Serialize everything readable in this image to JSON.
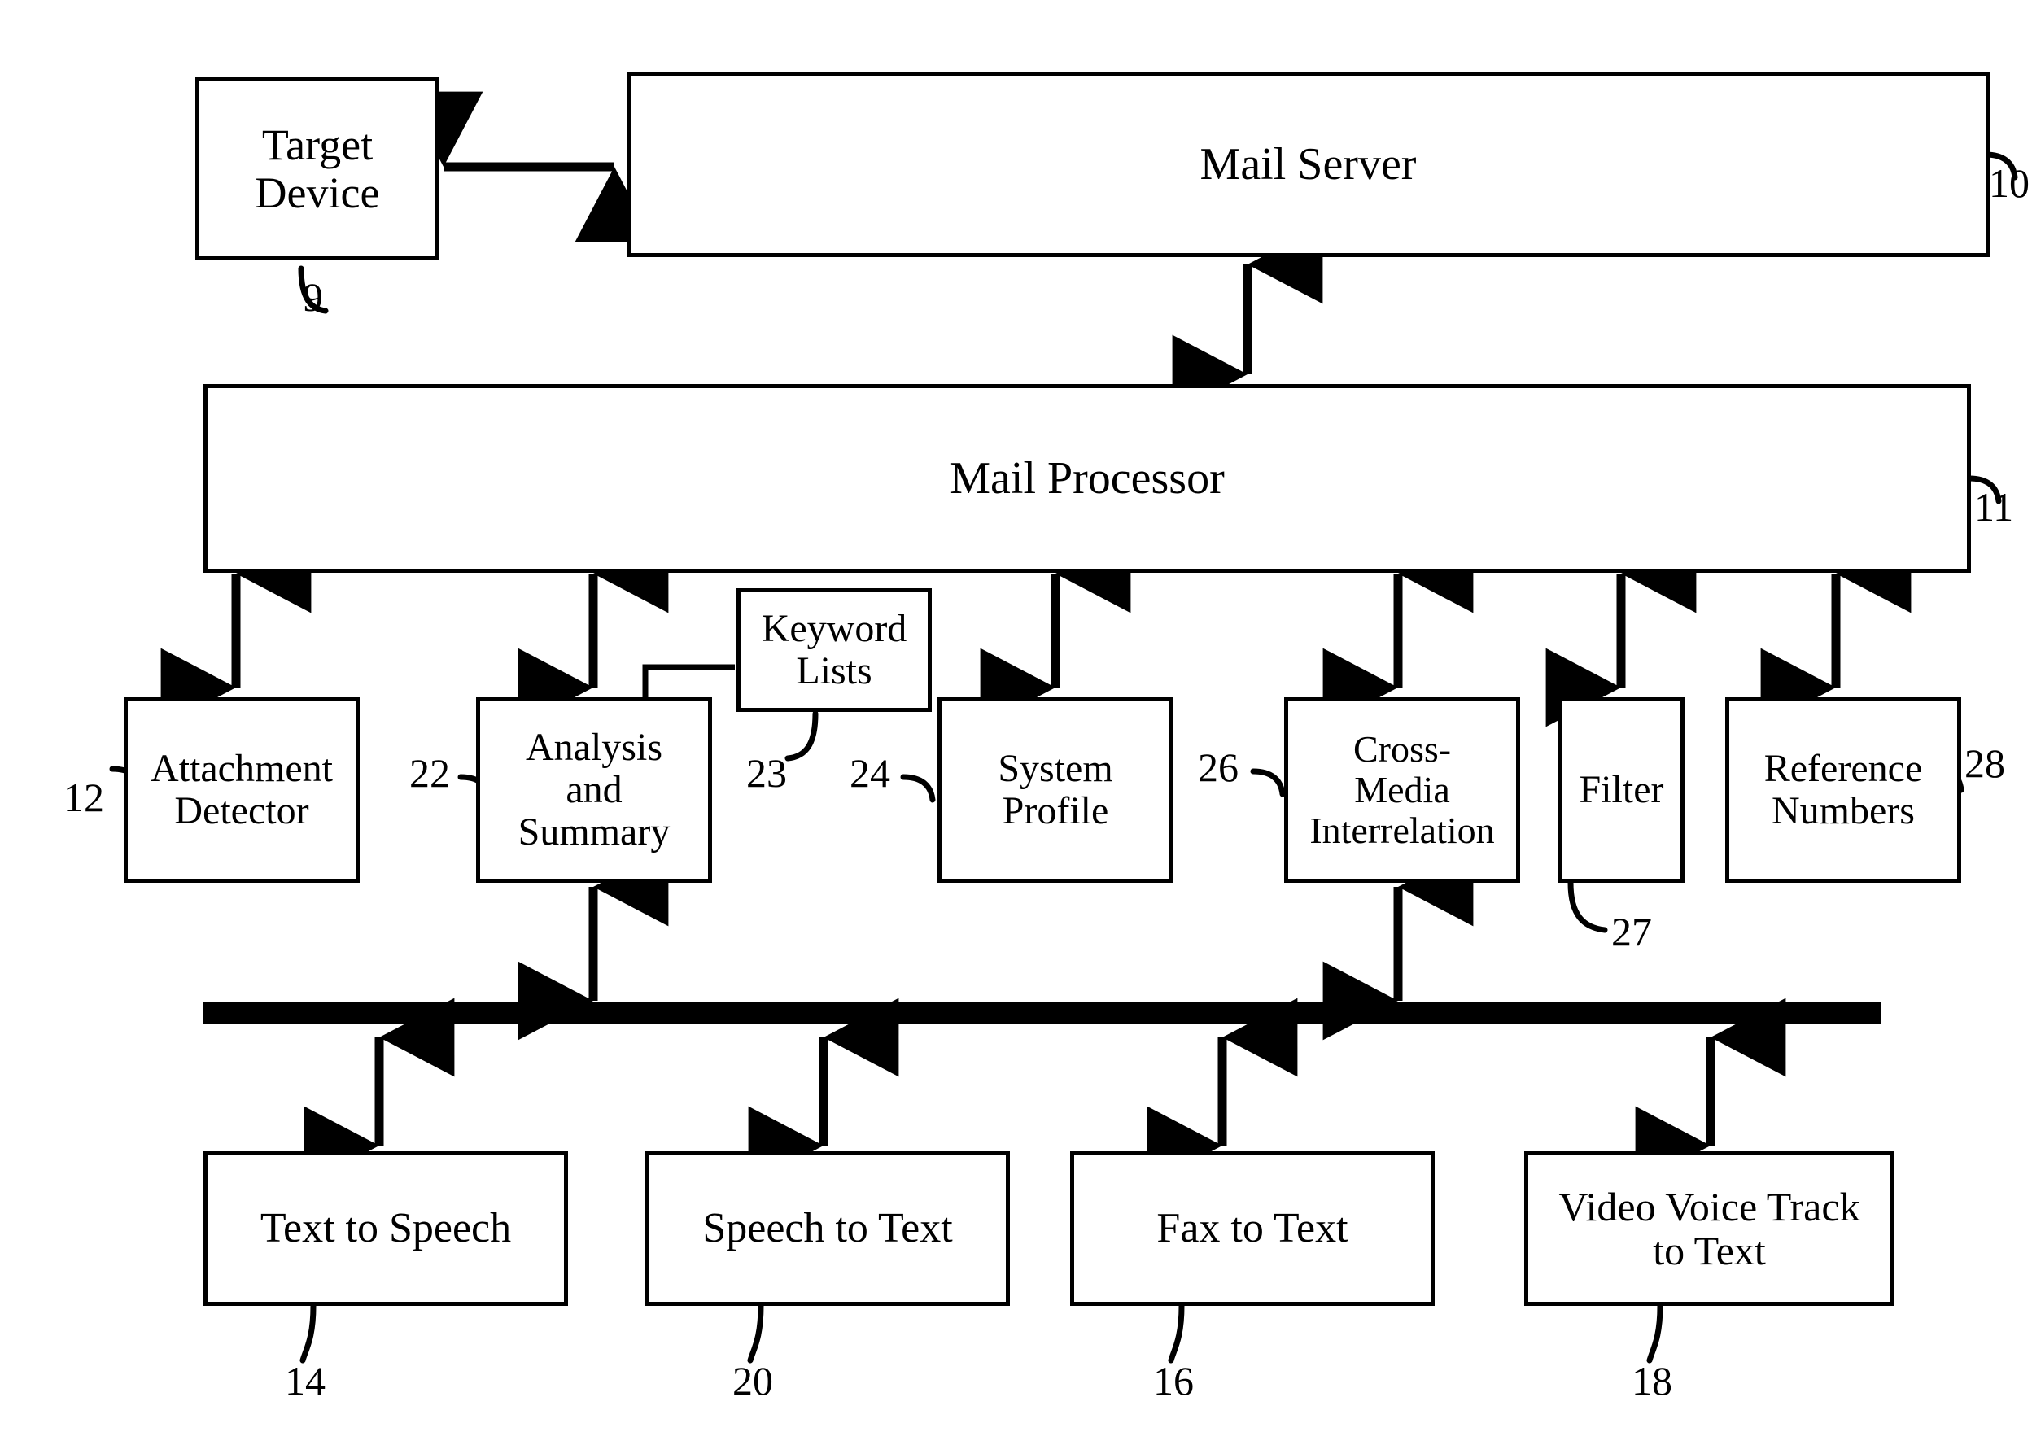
{
  "figure": {
    "kind": "patent-block-diagram",
    "background_color": "#ffffff",
    "line_color": "#000000"
  },
  "blocks": {
    "target_device": {
      "label": "Target\nDevice"
    },
    "mail_server": {
      "label": "Mail Server"
    },
    "mail_processor": {
      "label": "Mail Processor"
    },
    "attachment_detector": {
      "label": "Attachment\nDetector"
    },
    "analysis_and_summary": {
      "label": "Analysis\nand\nSummary"
    },
    "keyword_lists": {
      "label": "Keyword\nLists"
    },
    "system_profile": {
      "label": "System\nProfile"
    },
    "cross_media_interrelation": {
      "label": "Cross-\nMedia\nInterrelation"
    },
    "filter": {
      "label": "Filter"
    },
    "reference_numbers": {
      "label": "Reference\nNumbers"
    },
    "text_to_speech": {
      "label": "Text to Speech"
    },
    "speech_to_text": {
      "label": "Speech to Text"
    },
    "fax_to_text": {
      "label": "Fax to Text"
    },
    "video_voice_track_to_text": {
      "label": "Video Voice Track\nto Text"
    }
  },
  "reference_numerals": {
    "target_device": "9",
    "mail_server": "10",
    "mail_processor": "11",
    "attachment_detector": "12",
    "text_to_speech": "14",
    "fax_to_text": "16",
    "video_voice_track_to_text": "18",
    "speech_to_text": "20",
    "analysis_and_summary": "22",
    "keyword_lists": "23",
    "system_profile": "24",
    "cross_media_interrelation": "26",
    "filter": "27",
    "reference_numbers": "28"
  }
}
